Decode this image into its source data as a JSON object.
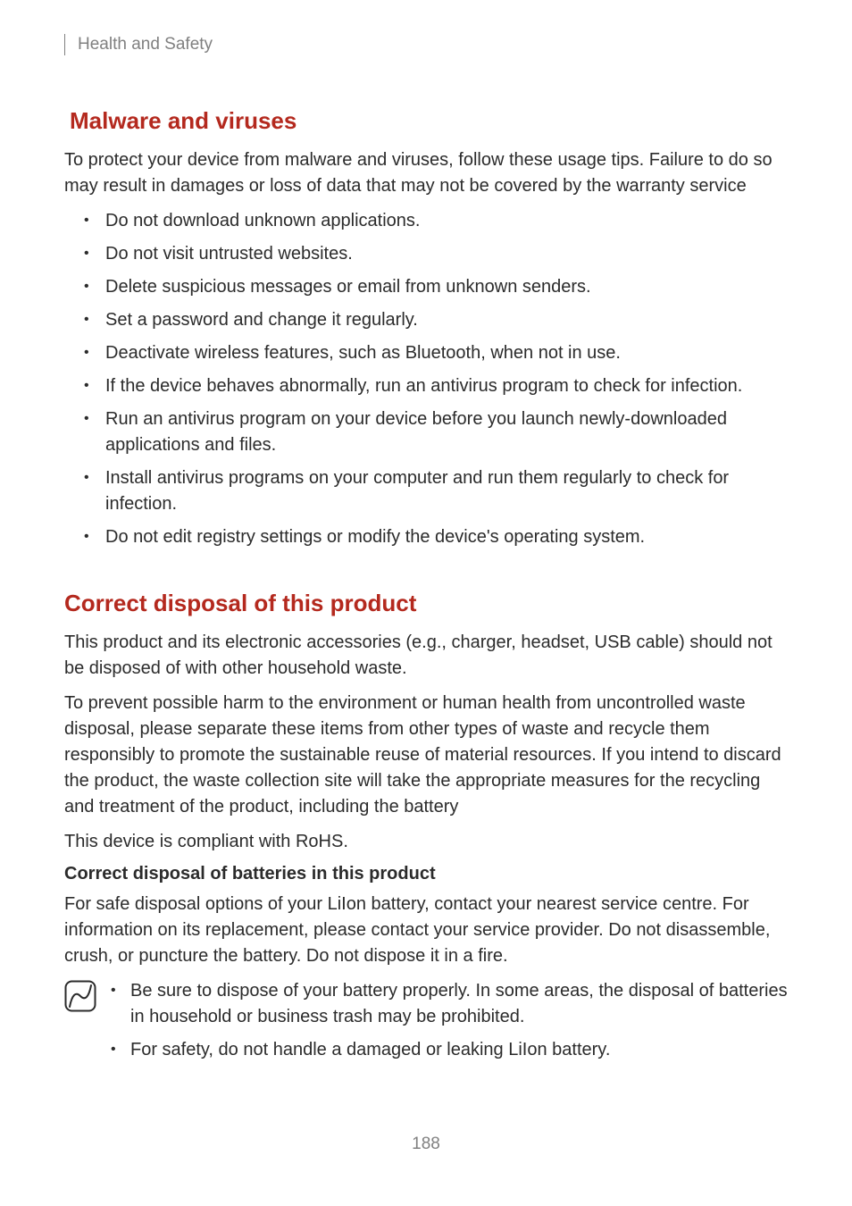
{
  "header": {
    "breadcrumb": "Health and Safety"
  },
  "section1": {
    "title": "Malware and viruses",
    "intro": "To protect your device from malware and viruses, follow these usage tips. Failure to do so may result in damages or loss of data that may not be covered by the warranty service",
    "bullets": [
      "Do not download unknown applications.",
      "Do not visit untrusted websites.",
      "Delete suspicious messages or email from unknown senders.",
      "Set a password and change it regularly.",
      "Deactivate wireless features, such as Bluetooth, when not in use.",
      "If the device behaves abnormally, run an antivirus program to check for infection.",
      "Run an antivirus program on your device before you launch newly-downloaded applications and files.",
      "Install antivirus programs on your computer and run them regularly to check for infection.",
      "Do not edit registry settings or modify the device's operating system."
    ]
  },
  "section2": {
    "title": "Correct disposal of this product",
    "p1": "This product and its electronic accessories (e.g., charger, headset, USB cable) should not be disposed of with other household waste.",
    "p2": "To prevent possible harm to the environment or human health from uncontrolled waste disposal, please separate these items from other types of waste and recycle them responsibly to promote the sustainable reuse of material resources. If you intend to discard the product, the waste collection site will take the appropriate measures for the recycling and treatment of the product, including the battery",
    "p3": "This device is compliant with RoHS.",
    "sub_title": "Correct disposal of batteries in this product",
    "p4": "For safe disposal options of your LiIon battery, contact your nearest service centre. For information on its replacement, please contact your service provider. Do not disassemble, crush, or puncture the battery. Do not dispose it in a fire.",
    "note_bullets": [
      "Be sure to dispose of your battery properly. In some areas, the disposal of batteries in household or business trash may be prohibited.",
      "For safety, do not handle a damaged or leaking LiIon battery."
    ]
  },
  "page_number": "188"
}
